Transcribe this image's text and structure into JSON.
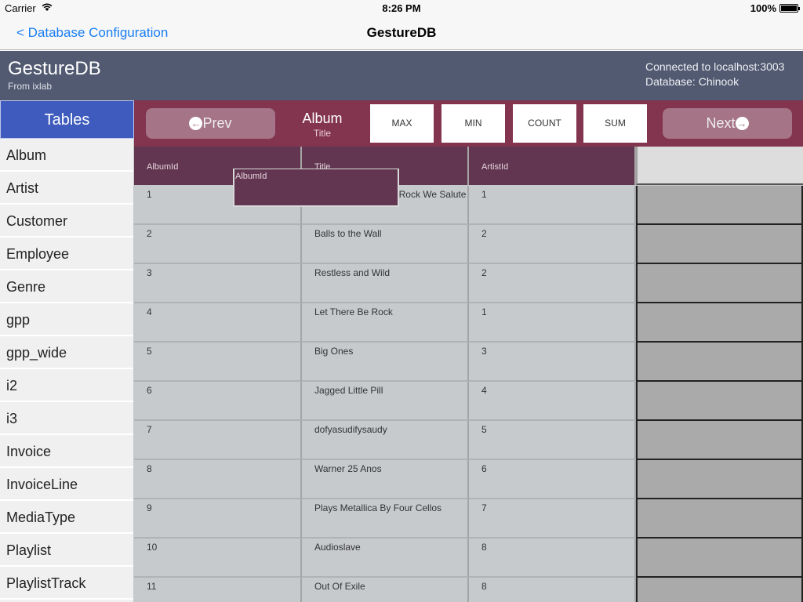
{
  "status_bar": {
    "carrier": "Carrier",
    "time": "8:26 PM",
    "battery": "100%"
  },
  "nav": {
    "back_label": "< Database Configuration",
    "title": "GestureDB"
  },
  "header": {
    "title": "GestureDB",
    "subtitle": "From ixlab",
    "connection": "Connected to localhost:3003",
    "database": "Database: Chinook"
  },
  "sidebar": {
    "heading": "Tables",
    "items": [
      "Album",
      "Artist",
      "Customer",
      "Employee",
      "Genre",
      "gpp",
      "gpp_wide",
      "i2",
      "i3",
      "Invoice",
      "InvoiceLine",
      "MediaType",
      "Playlist",
      "PlaylistTrack"
    ]
  },
  "toolbar": {
    "prev_label": "Prev",
    "next_label": "Next",
    "table_name": "Album",
    "column_name": "Title",
    "aggregates": [
      "MAX",
      "MIN",
      "COUNT",
      "SUM"
    ]
  },
  "grid": {
    "columns": [
      "AlbumId",
      "Title",
      "ArtistId"
    ],
    "rows": [
      [
        "1",
        "For Those About To Rock We Salute You",
        "1"
      ],
      [
        "2",
        "Balls to the Wall",
        "2"
      ],
      [
        "3",
        "Restless and Wild",
        "2"
      ],
      [
        "4",
        "Let There Be Rock",
        "1"
      ],
      [
        "5",
        "Big Ones",
        "3"
      ],
      [
        "6",
        "Jagged Little Pill",
        "4"
      ],
      [
        "7",
        "dofyasudifysaudy",
        "5"
      ],
      [
        "8",
        "Warner 25 Anos",
        "6"
      ],
      [
        "9",
        "Plays Metallica By Four Cellos",
        "7"
      ],
      [
        "10",
        "Audioslave",
        "8"
      ],
      [
        "11",
        "Out Of Exile",
        "8"
      ]
    ],
    "drag_label": "AlbumId"
  }
}
